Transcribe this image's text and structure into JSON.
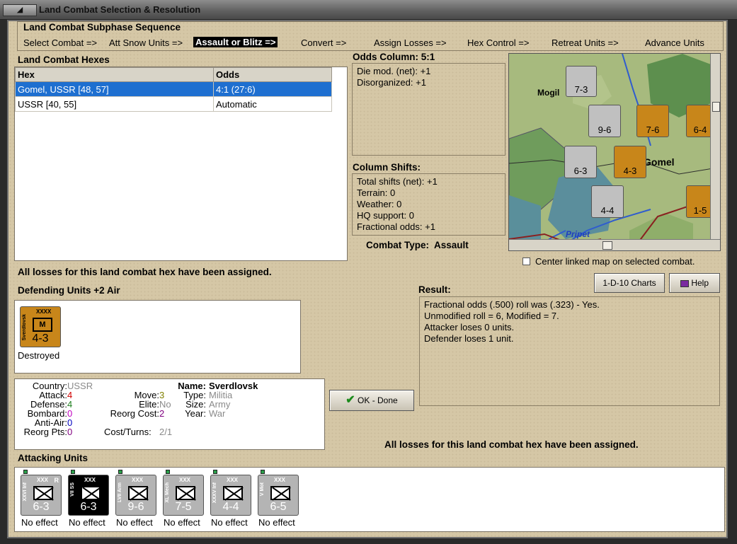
{
  "window": {
    "title": "Land Combat Selection & Resolution"
  },
  "sequence": {
    "heading": "Land Combat Subphase Sequence",
    "steps": [
      "Select Combat =>",
      "Att Snow Units =>",
      "Assault or Blitz =>",
      "Convert =>",
      "Assign Losses =>",
      "Hex Control =>",
      "Retreat Units =>",
      "Advance Units"
    ],
    "active_index": 2
  },
  "hexes": {
    "heading": "Land Combat Hexes",
    "columns": [
      "Hex",
      "Odds"
    ],
    "rows": [
      {
        "hex": "Gomel, USSR [48, 57]",
        "odds": "4:1 (27:6)",
        "selected": true
      },
      {
        "hex": "USSR [40, 55]",
        "odds": "Automatic",
        "selected": false
      }
    ]
  },
  "odds": {
    "heading": "Odds Column: 5:1",
    "lines": [
      "Die mod. (net): +1",
      "Disorganized: +1"
    ]
  },
  "shifts": {
    "heading": "Column Shifts:",
    "lines": [
      "Total shifts (net): +1",
      "Terrain: 0",
      "Weather: 0",
      "HQ support: 0",
      "Fractional odds: +1"
    ]
  },
  "combat_type": {
    "label": "Combat Type:",
    "value": "Assault"
  },
  "map": {
    "labels": {
      "city": "Gomel",
      "city_prefix": "Mogil",
      "river": "Pripet"
    },
    "counters": [
      {
        "value": "7-3",
        "corner": "2",
        "unit": "XXX"
      },
      {
        "value": "9-6",
        "corner": "2",
        "unit": "XXX"
      },
      {
        "value": "7-6",
        "corner": "3",
        "unit": "XXXX"
      },
      {
        "value": "6-4",
        "corner": "3",
        "unit": "XXX"
      },
      {
        "value": "6-3",
        "corner": "2",
        "unit": "XXX"
      },
      {
        "value": "4-3",
        "corner": "",
        "unit": "XXXX"
      },
      {
        "value": "4-4",
        "corner": "",
        "unit": "XXX"
      },
      {
        "value": "1-5",
        "corner": "3",
        "unit": ""
      }
    ]
  },
  "center_link": {
    "label": "Center linked map on selected combat.",
    "checked": false
  },
  "status_message": "All losses for this land combat hex have been assigned.",
  "buttons": {
    "charts": "1-D-10 Charts",
    "help": "Help",
    "ok": "OK - Done"
  },
  "defending": {
    "heading": "Defending Units +2 Air",
    "units": [
      {
        "name": "Sverdlovsk",
        "unit_size": "XXXX",
        "value": "4-3",
        "type_mark": "M",
        "result": "Destroyed"
      }
    ]
  },
  "details": {
    "country_label": "Country:",
    "country": "USSR",
    "attack_label": "Attack:",
    "attack": "4",
    "defense_label": "Defense:",
    "defense": "4",
    "bombard_label": "Bombard:",
    "bombard": "0",
    "antiair_label": "Anti-Air:",
    "antiair": "0",
    "reorgpts_label": "Reorg Pts:",
    "reorgpts": "0",
    "move_label": "Move:",
    "move": "3",
    "elite_label": "Elite:",
    "elite": "No",
    "reorgcost_label": "Reorg Cost:",
    "reorgcost": "2",
    "costturns_label": "Cost/Turns:",
    "costturns": "2/1",
    "name_label": "Name:",
    "name": "Sverdlovsk",
    "type_label": "Type:",
    "type": "Militia",
    "size_label": "Size:",
    "size": "Army",
    "year_label": "Year:",
    "year": "War"
  },
  "result": {
    "heading": "Result:",
    "lines": [
      "Fractional odds (.500) roll was (.323)  - Yes.",
      "Unmodified roll = 6, Modified = 7.",
      "Attacker loses 0 units.",
      "Defender loses 1 unit."
    ]
  },
  "final_message": "All losses for this land combat hex have been assigned.",
  "attacking": {
    "heading": "Attacking Units",
    "units": [
      {
        "name": "XXVI Inf",
        "value": "6-3",
        "corner": "R",
        "result": "No effect",
        "style": "gray"
      },
      {
        "name": "VII SS",
        "value": "6-3",
        "corner": "",
        "result": "No effect",
        "style": "black"
      },
      {
        "name": "LVII Arm",
        "value": "9-6",
        "corner": "",
        "result": "No effect",
        "style": "gray"
      },
      {
        "name": "XL Mech",
        "value": "7-5",
        "corner": "",
        "result": "No effect",
        "style": "gray"
      },
      {
        "name": "XXXV Inf",
        "value": "4-4",
        "corner": "",
        "result": "No effect",
        "style": "gray"
      },
      {
        "name": "V Mot",
        "value": "6-5",
        "corner": "",
        "result": "No effect",
        "style": "gray"
      }
    ]
  },
  "colors": {
    "window_bg": "#d5c7a6",
    "selection": "#1e6fd0",
    "defender_counter": "#c8861a",
    "attacker_counter": "#b4b4b4",
    "val_red": "#d00000",
    "val_green": "#208020",
    "val_magenta": "#c000c0",
    "val_blue": "#0000c0",
    "val_olive": "#808000",
    "val_purple": "#800080",
    "val_gray": "#8a8a8a"
  }
}
